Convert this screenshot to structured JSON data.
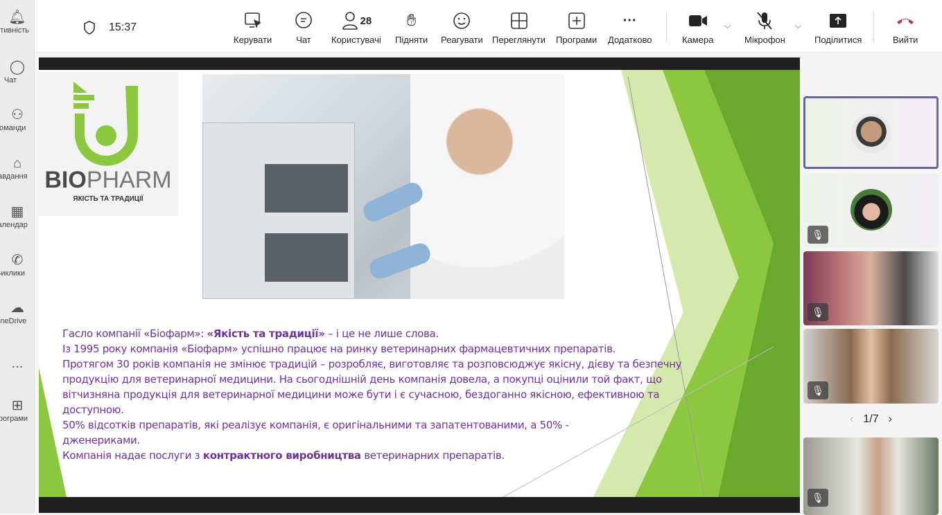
{
  "rail": {
    "items": [
      {
        "label": "Активність",
        "icon": "bell-icon"
      },
      {
        "label": "Чат",
        "icon": "chat-icon"
      },
      {
        "label": "Команди",
        "icon": "teams-icon"
      },
      {
        "label": "Завдання",
        "icon": "tasks-icon"
      },
      {
        "label": "Календар",
        "icon": "calendar-icon"
      },
      {
        "label": "Виклики",
        "icon": "phone-icon"
      },
      {
        "label": "OneDrive",
        "icon": "cloud-icon"
      },
      {
        "label": "...",
        "icon": "more-icon"
      },
      {
        "label": "Програми",
        "icon": "apps-icon"
      }
    ]
  },
  "header": {
    "time": "15:37",
    "participants_count": "28",
    "buttons": {
      "control": "Керувати",
      "chat": "Чат",
      "people": "Користувачі",
      "raise": "Підняти",
      "react": "Реагувати",
      "view": "Переглянути",
      "apps": "Програми",
      "more": "Додатково",
      "camera": "Камера",
      "mic": "Мікрофон",
      "share": "Поділитися",
      "leave": "Вийти"
    }
  },
  "slide": {
    "logo_text": "BIOPHARM",
    "logo_tagline": "ЯКІСТЬ ТА ТРАДИЦІЇ",
    "lines": {
      "l1a": "Гасло компанії «Біофарм»: ",
      "l1b": "«Якість та традиції»",
      "l1c": " – і це не лише слова.",
      "l2": "Із 1995 року компанія «Біофарм» успішно працює на ринку ветеринарних фармацевтичних препаратів.",
      "l3": "Протягом 30 років компанія не змінює традицій – розробляє, виготовляє та розповсюджує якісну, дієву та безпечну продукцію для ветеринарної медицини. На сьогоднішній день компанія довела, а покупці оцінили той факт, що вітчизняна продукція для ветеринарної медицини може бути і є сучасною, бездоганно якісною, ефективною та доступною.",
      "l4": "50% відсотків препаратів, які реалізує компанія, є оригінальними та запатентованими, а 50% - дженериками.",
      "l5a": "Компанія надає послуги з ",
      "l5b": "контрактного виробництва",
      "l5c": " ветеринарних препаратів."
    }
  },
  "colors": {
    "accent": "#6264a7",
    "slide_text": "#7030a0",
    "green": "#8dc63f",
    "leave": "#c4314b"
  },
  "pager": {
    "label": "1/7"
  }
}
